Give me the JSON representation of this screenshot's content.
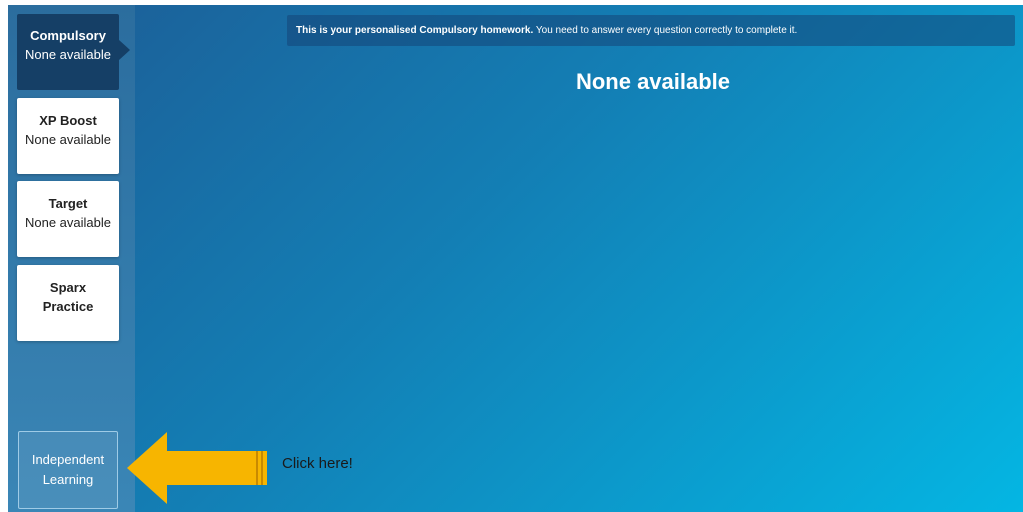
{
  "sidebar": {
    "tabs": [
      {
        "title": "Compulsory",
        "subtitle": "None available"
      },
      {
        "title": "XP Boost",
        "subtitle": "None available"
      },
      {
        "title": "Target",
        "subtitle": "None available"
      },
      {
        "title": "Sparx",
        "subtitle": "Practice"
      }
    ],
    "independent": {
      "line1": "Independent",
      "line2": "Learning"
    }
  },
  "banner": {
    "bold": "This is your personalised Compulsory homework.",
    "rest": " You need to answer every question correctly to complete it."
  },
  "main": {
    "title": "None available"
  },
  "annotation": {
    "text": "Click here!",
    "arrow_color": "#f7b500"
  },
  "colors": {
    "active_tab": "#153f66",
    "accent": "#04b6e3"
  }
}
